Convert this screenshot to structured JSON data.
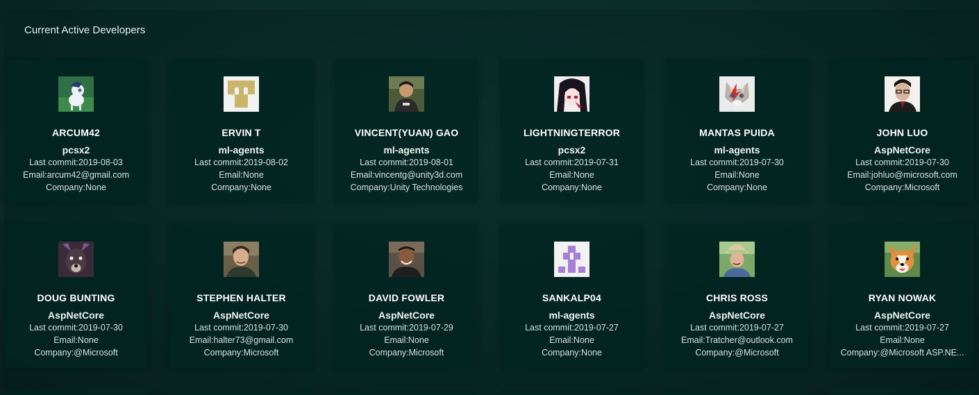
{
  "page": {
    "title": "Current Active Developers"
  },
  "developers": [
    {
      "name": "ARCUM42",
      "repo": "pcsx2",
      "last_commit": "Last commit:2019-08-03",
      "email": "Email:arcum42@gmail.com",
      "company": "Company:None",
      "avatar_icon": "pony-avatar-icon"
    },
    {
      "name": "ERVIN T",
      "repo": "ml-agents",
      "last_commit": "Last commit:2019-08-02",
      "email": "Email:None",
      "company": "Company:None",
      "avatar_icon": "identicon-avatar-icon"
    },
    {
      "name": "VINCENT(YUAN) GAO",
      "repo": "ml-agents",
      "last_commit": "Last commit:2019-08-01",
      "email": "Email:vincentg@unity3d.com",
      "company": "Company:Unity Technologies",
      "avatar_icon": "photo-avatar-icon"
    },
    {
      "name": "LIGHTNINGTERROR",
      "repo": "pcsx2",
      "last_commit": "Last commit:2019-07-31",
      "email": "Email:None",
      "company": "Company:None",
      "avatar_icon": "anime-avatar-icon"
    },
    {
      "name": "MANTAS PUIDA",
      "repo": "ml-agents",
      "last_commit": "Last commit:2019-07-30",
      "email": "Email:None",
      "company": "Company:None",
      "avatar_icon": "cat-avatar-icon"
    },
    {
      "name": "JOHN LUO",
      "repo": "AspNetCore",
      "last_commit": "Last commit:2019-07-30",
      "email": "Email:johluo@microsoft.com",
      "company": "Company:Microsoft",
      "avatar_icon": "photo-avatar-icon"
    },
    {
      "name": "DOUG BUNTING",
      "repo": "AspNetCore",
      "last_commit": "Last commit:2019-07-30",
      "email": "Email:None",
      "company": "Company:@Microsoft",
      "avatar_icon": "dog-avatar-icon"
    },
    {
      "name": "STEPHEN HALTER",
      "repo": "AspNetCore",
      "last_commit": "Last commit:2019-07-30",
      "email": "Email:halter73@gmail.com",
      "company": "Company:Microsoft",
      "avatar_icon": "photo-avatar-icon"
    },
    {
      "name": "DAVID FOWLER",
      "repo": "AspNetCore",
      "last_commit": "Last commit:2019-07-29",
      "email": "Email:None",
      "company": "Company:Microsoft",
      "avatar_icon": "photo-avatar-icon"
    },
    {
      "name": "SANKALP04",
      "repo": "ml-agents",
      "last_commit": "Last commit:2019-07-27",
      "email": "Email:None",
      "company": "Company:None",
      "avatar_icon": "identicon-avatar-icon"
    },
    {
      "name": "CHRIS ROSS",
      "repo": "AspNetCore",
      "last_commit": "Last commit:2019-07-27",
      "email": "Email:Tratcher@outlook.com",
      "company": "Company:@Microsoft",
      "avatar_icon": "photo-avatar-icon"
    },
    {
      "name": "RYAN NOWAK",
      "repo": "AspNetCore",
      "last_commit": "Last commit:2019-07-27",
      "email": "Email:None",
      "company": "Company:@Microsoft ASP.NE...",
      "avatar_icon": "corgi-avatar-icon"
    }
  ]
}
